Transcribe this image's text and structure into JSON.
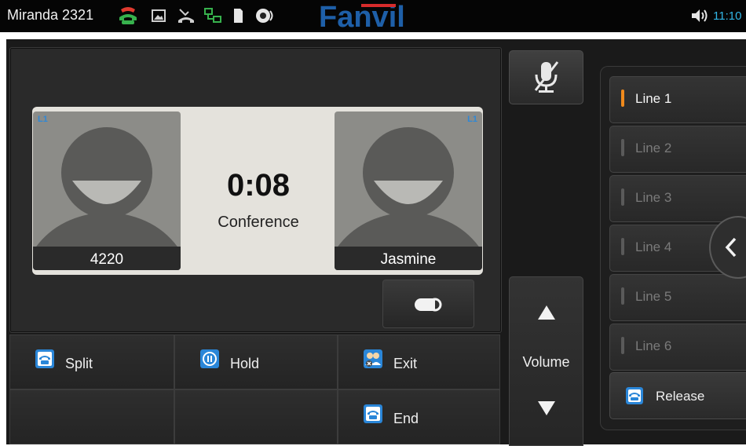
{
  "status_bar": {
    "user_label": "Miranda  2321",
    "time": "11:10",
    "brand": "Fanvil",
    "icons": [
      "phone-icon",
      "picture-icon",
      "missed-call-icon",
      "network-icon",
      "sd-card-icon",
      "speaker-icon"
    ]
  },
  "call": {
    "timer": "0:08",
    "state": "Conference",
    "participants": [
      {
        "line": "L1",
        "name": "4220"
      },
      {
        "line": "L1",
        "name": "Jasmine"
      }
    ]
  },
  "actions": {
    "split": "Split",
    "hold": "Hold",
    "exit": "Exit",
    "end": "End"
  },
  "volume": {
    "label": "Volume"
  },
  "lines": {
    "items": [
      "Line 1",
      "Line 2",
      "Line 3",
      "Line 4",
      "Line 5",
      "Line 6"
    ],
    "active_index": 0,
    "release": "Release"
  },
  "colors": {
    "accent_blue": "#31b6e7",
    "active_line": "#f08a1c",
    "icon_blue": "#2a86d8"
  }
}
